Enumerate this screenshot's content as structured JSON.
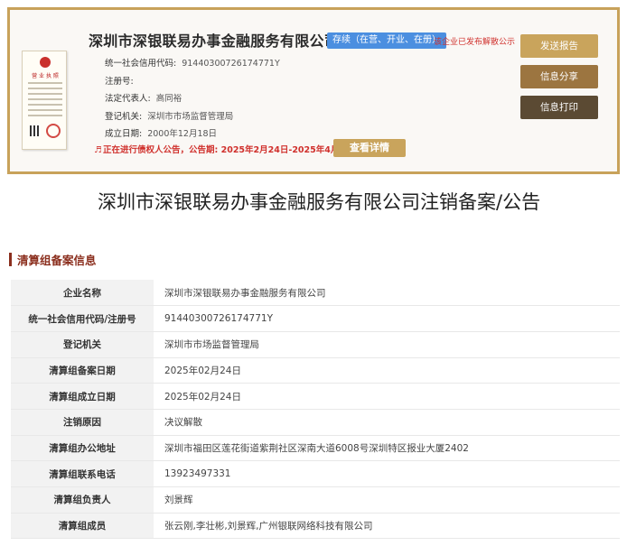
{
  "header": {
    "company_name": "深圳市深银联易办事金融服务有限公司",
    "status_badge": "存续（在营、开业、在册）",
    "notice_red": "该企业已发布解散公示",
    "info": [
      {
        "label": "统一社会信用代码:",
        "value": "91440300726174771Y"
      },
      {
        "label": "注册号:",
        "value": ""
      },
      {
        "label": "法定代表人:",
        "value": "高同裕"
      },
      {
        "label": "登记机关:",
        "value": "深圳市市场监督管理局"
      },
      {
        "label": "成立日期:",
        "value": "2000年12月18日"
      }
    ],
    "alert": "正在进行债权人公告，公告期:  2025年2月24日-2025年4月10日",
    "detail_button": "查看详情",
    "side_buttons": {
      "report": "发送报告",
      "share": "信息分享",
      "print": "信息打印"
    },
    "license_title": "营 业 执 照"
  },
  "page_title": "深圳市深银联易办事金融服务有限公司注销备案/公告",
  "section_title": "清算组备案信息",
  "table": [
    {
      "key": "企业名称",
      "value": "深圳市深银联易办事金融服务有限公司"
    },
    {
      "key": "统一社会信用代码/注册号",
      "value": "91440300726174771Y"
    },
    {
      "key": "登记机关",
      "value": "深圳市市场监督管理局"
    },
    {
      "key": "清算组备案日期",
      "value": "2025年02月24日"
    },
    {
      "key": "清算组成立日期",
      "value": "2025年02月24日"
    },
    {
      "key": "注销原因",
      "value": "决议解散"
    },
    {
      "key": "清算组办公地址",
      "value": "深圳市福田区莲花街道紫荆社区深南大道6008号深圳特区报业大厦2402"
    },
    {
      "key": "清算组联系电话",
      "value": "13923497331"
    },
    {
      "key": "清算组负责人",
      "value": "刘景辉"
    },
    {
      "key": "清算组成员",
      "value": "张云刚,李壮彬,刘景辉,广州银联网络科技有限公司"
    }
  ],
  "colors": {
    "card_border": "#c8a25a",
    "status_badge": "#4b8fe0",
    "alert_red": "#d0312d",
    "btn_report": "#c9a45c",
    "btn_share": "#9c7540",
    "btn_print": "#5b4a33",
    "section_accent": "#8b2f1e"
  },
  "icons": {
    "license_thumbnail": "business-license-image",
    "alert_icon": "speaker-icon"
  }
}
